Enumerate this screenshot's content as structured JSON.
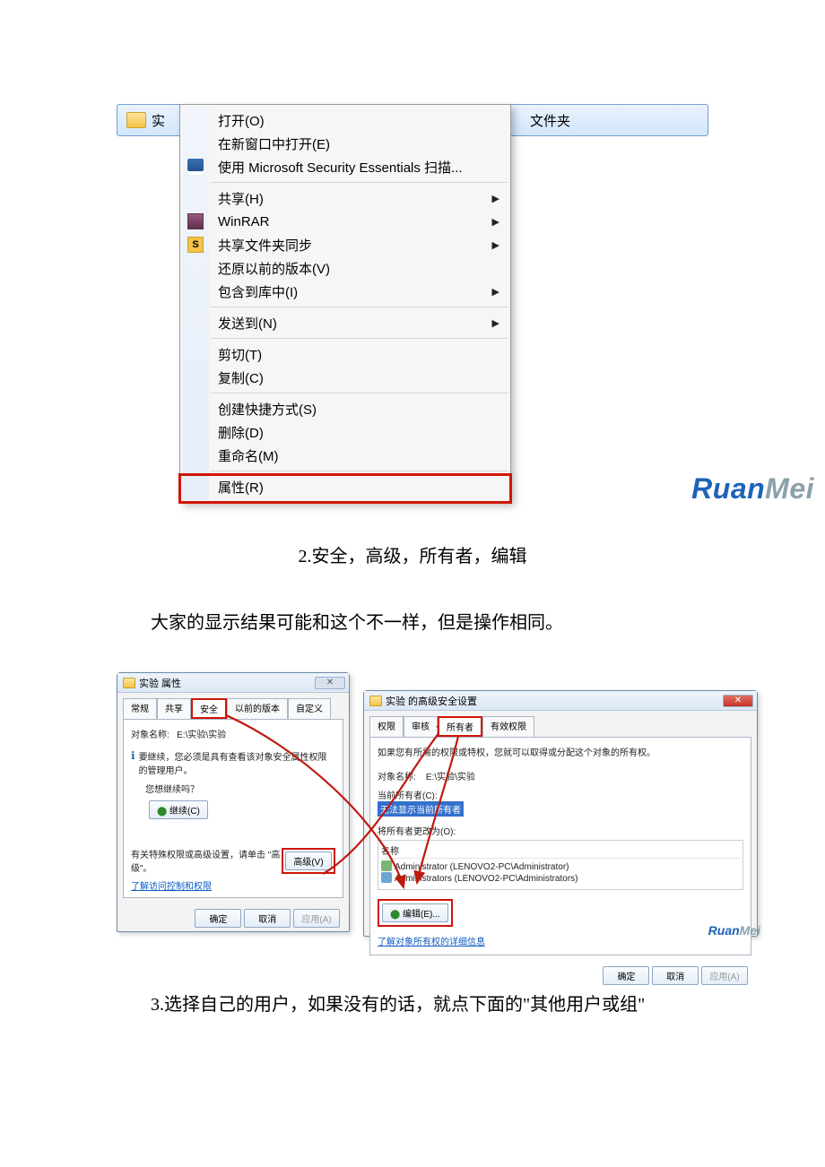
{
  "fig1": {
    "bluebar": {
      "name_prefix": "实",
      "type": "文件夹"
    },
    "menu": {
      "groups": [
        [
          {
            "label": "打开(O)",
            "icon": null,
            "arrow": false
          },
          {
            "label": "在新窗口中打开(E)",
            "icon": null,
            "arrow": false
          },
          {
            "label": "使用 Microsoft Security Essentials 扫描...",
            "icon": "shield",
            "arrow": false
          }
        ],
        [
          {
            "label": "共享(H)",
            "icon": null,
            "arrow": true
          },
          {
            "label": "WinRAR",
            "icon": "rar",
            "arrow": true
          },
          {
            "label": "共享文件夹同步",
            "icon": "s",
            "arrow": true
          },
          {
            "label": "还原以前的版本(V)",
            "icon": null,
            "arrow": false
          },
          {
            "label": "包含到库中(I)",
            "icon": null,
            "arrow": true
          }
        ],
        [
          {
            "label": "发送到(N)",
            "icon": null,
            "arrow": true
          }
        ],
        [
          {
            "label": "剪切(T)",
            "icon": null,
            "arrow": false
          },
          {
            "label": "复制(C)",
            "icon": null,
            "arrow": false
          }
        ],
        [
          {
            "label": "创建快捷方式(S)",
            "icon": null,
            "arrow": false
          },
          {
            "label": "删除(D)",
            "icon": null,
            "arrow": false
          },
          {
            "label": "重命名(M)",
            "icon": null,
            "arrow": false
          }
        ],
        [
          {
            "label": "属性(R)",
            "icon": null,
            "arrow": false,
            "hl": true
          }
        ]
      ]
    },
    "logo_blue": "Ruan",
    "logo_gray": "Mei"
  },
  "text": {
    "p1": "2.安全，高级，所有者，编辑",
    "p2": "大家的显示结果可能和这个不一样，但是操作相同。",
    "p3": "3.选择自己的用户，如果没有的话，就点下面的\"其他用户或组\""
  },
  "dlgA": {
    "title": "实验 属性",
    "close": "✕",
    "tabs": [
      "常规",
      "共享",
      "安全",
      "以前的版本",
      "自定义"
    ],
    "activeTab": 2,
    "objLabel": "对象名称:",
    "objPath": "E:\\实验\\实验",
    "warn1": "要继续，您必须是具有查看该对象安全属性权限的管理用户。",
    "warn2": "您想继续吗？",
    "btnContinue": "继续(C)",
    "advText": "有关特殊权限或高级设置，请单击 \"高级\"。",
    "btnAdv": "高级(V)",
    "link": "了解访问控制和权限",
    "ok": "确定",
    "cancel": "取消",
    "apply": "应用(A)"
  },
  "dlgB": {
    "title": "实验 的高级安全设置",
    "close": "✕",
    "tabs": [
      "权限",
      "审核",
      "所有者",
      "有效权限"
    ],
    "activeTab": 2,
    "line1": "如果您有所需的权限或特权，您就可以取得或分配这个对象的所有权。",
    "objLabel": "对象名称:",
    "objPath": "E:\\实验\\实验",
    "curOwnerLbl": "当前所有者(C):",
    "curOwnerVal": "无法显示当前所有者",
    "chgLbl": "将所有者更改为(O):",
    "listHdr": "名称",
    "owners": [
      {
        "icon": "user",
        "text": "Administrator (LENOVO2-PC\\Administrator)"
      },
      {
        "icon": "grp",
        "text": "Administrators (LENOVO2-PC\\Administrators)"
      }
    ],
    "btnEdit": "编辑(E)...",
    "link": "了解对象所有权的详细信息",
    "ok": "确定",
    "cancel": "取消",
    "apply": "应用(A)",
    "logo_blue": "Ruan",
    "logo_gray": "Mei"
  }
}
